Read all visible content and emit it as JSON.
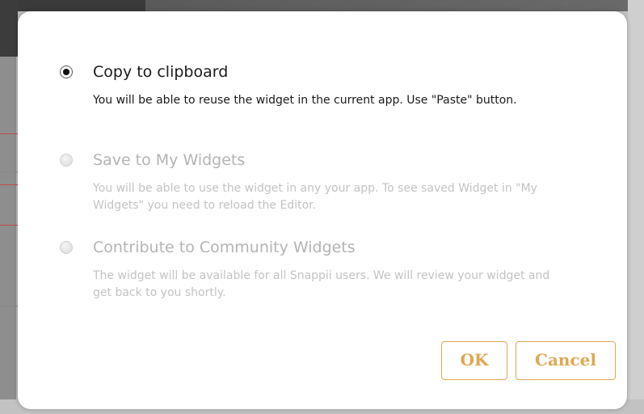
{
  "dialog": {
    "options": [
      {
        "title": "Copy to clipboard",
        "description": "You will be able to reuse the widget in the current app. Use \"Paste\" button.",
        "selected": true,
        "enabled": true
      },
      {
        "title": "Save to My Widgets",
        "description": "You will be able to use the widget in any your app. To see saved Widget in \"My Widgets\" you need to reload the Editor.",
        "selected": false,
        "enabled": false
      },
      {
        "title": "Contribute to Community Widgets",
        "description": "The widget will be available for all Snappii users. We will review your widget and get back to you shortly.",
        "selected": false,
        "enabled": false
      }
    ],
    "buttons": {
      "ok_label": "OK",
      "cancel_label": "Cancel"
    }
  },
  "colors": {
    "accent": "#e0a650",
    "text": "#1a1a1a",
    "disabled_text": "#c3c3c3",
    "dialog_background": "#ffffff"
  }
}
